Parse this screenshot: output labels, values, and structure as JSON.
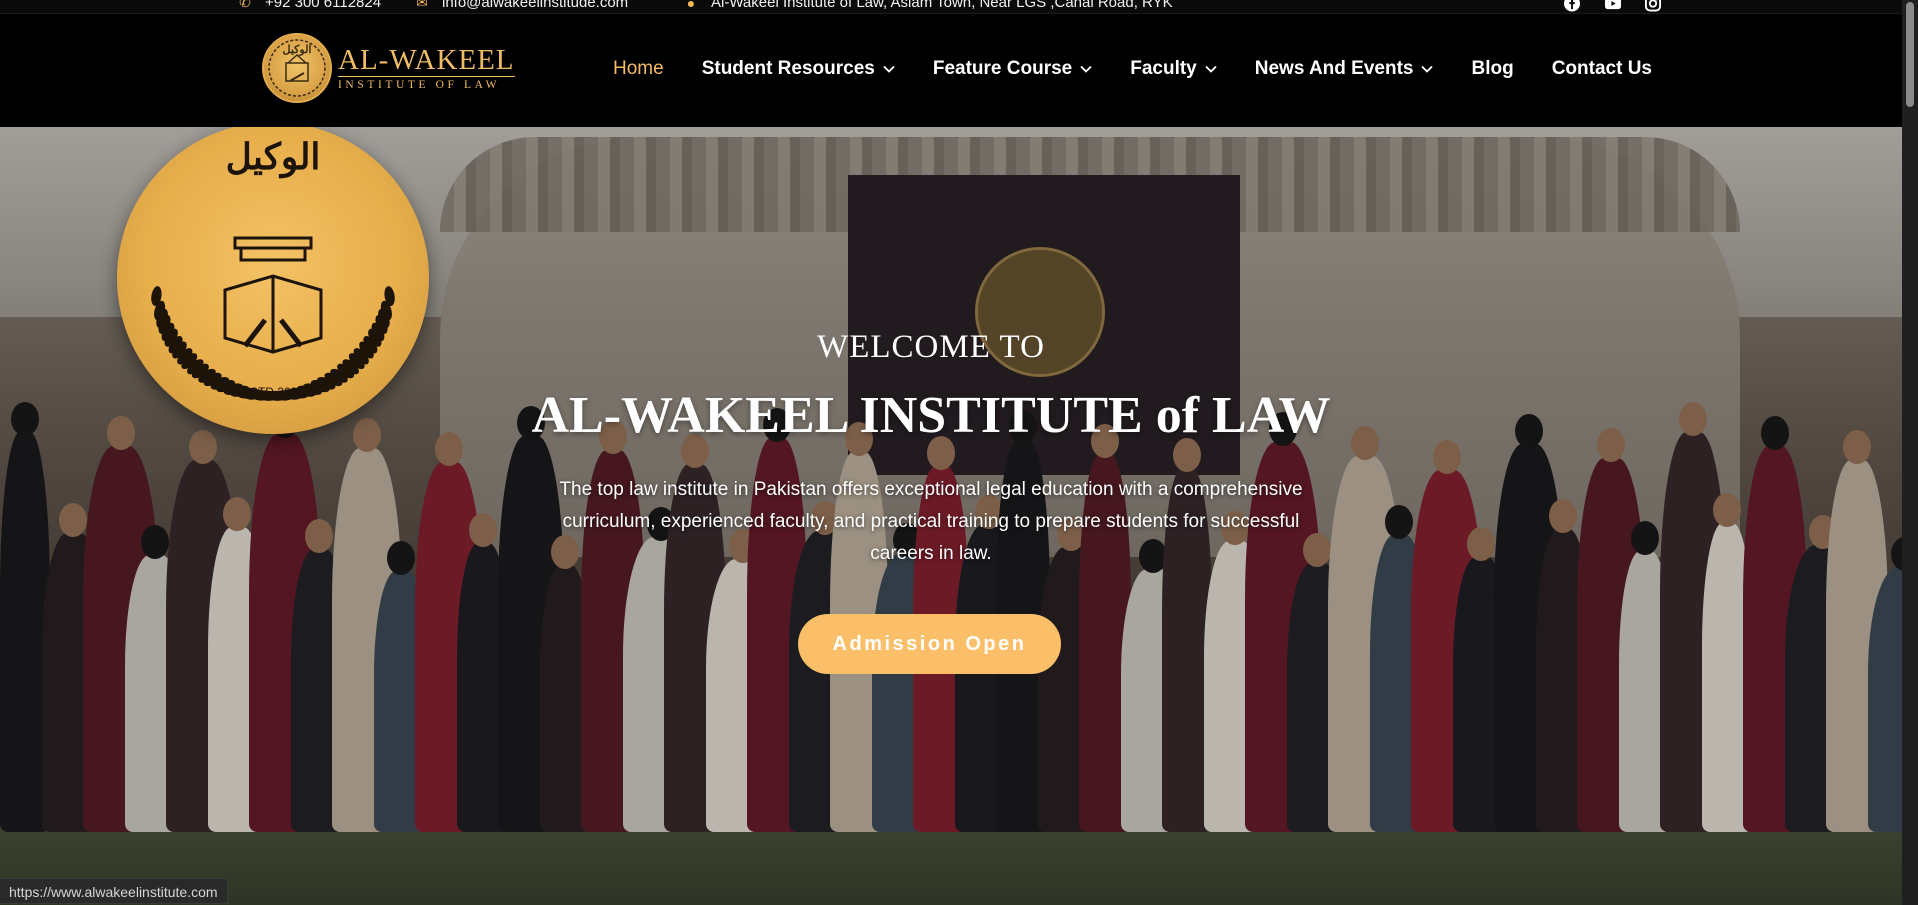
{
  "topbar": {
    "phone": "+92 300 6112824",
    "email": "info@alwakeelinstitude.com",
    "address": "Al-Wakeel Institute of Law, Aslam Town, Near LGS ,Canal Road, RYK",
    "social": [
      "facebook-icon",
      "youtube-icon",
      "instagram-icon"
    ]
  },
  "logo": {
    "name": "AL-WAKEEL",
    "tagline": "INSTITUTE OF LAW",
    "emblem_text": "الوکیل"
  },
  "nav": {
    "items": [
      {
        "label": "Home",
        "active": true,
        "dropdown": false
      },
      {
        "label": "Student Resources",
        "active": false,
        "dropdown": true
      },
      {
        "label": "Feature Course",
        "active": false,
        "dropdown": true
      },
      {
        "label": "Faculty",
        "active": false,
        "dropdown": true
      },
      {
        "label": "News And Events",
        "active": false,
        "dropdown": true
      },
      {
        "label": "Blog",
        "active": false,
        "dropdown": false
      },
      {
        "label": "Contact Us",
        "active": false,
        "dropdown": false
      }
    ]
  },
  "hero": {
    "seal_text": "الوکیل",
    "seal_year": "ESTD 2024",
    "welcome": "WELCOME TO",
    "title": "AL-WAKEEL INSTITUTE of LAW",
    "description": "The top law institute in Pakistan offers exceptional legal education with a comprehensive curriculum, experienced faculty, and practical training to prepare students for successful careers in law.",
    "cta": "Admission Open"
  },
  "status_url": "https://www.alwakeelinstitute.com",
  "colors": {
    "accent": "#f6b964",
    "button": "#fbbf69",
    "background": "#000000"
  }
}
